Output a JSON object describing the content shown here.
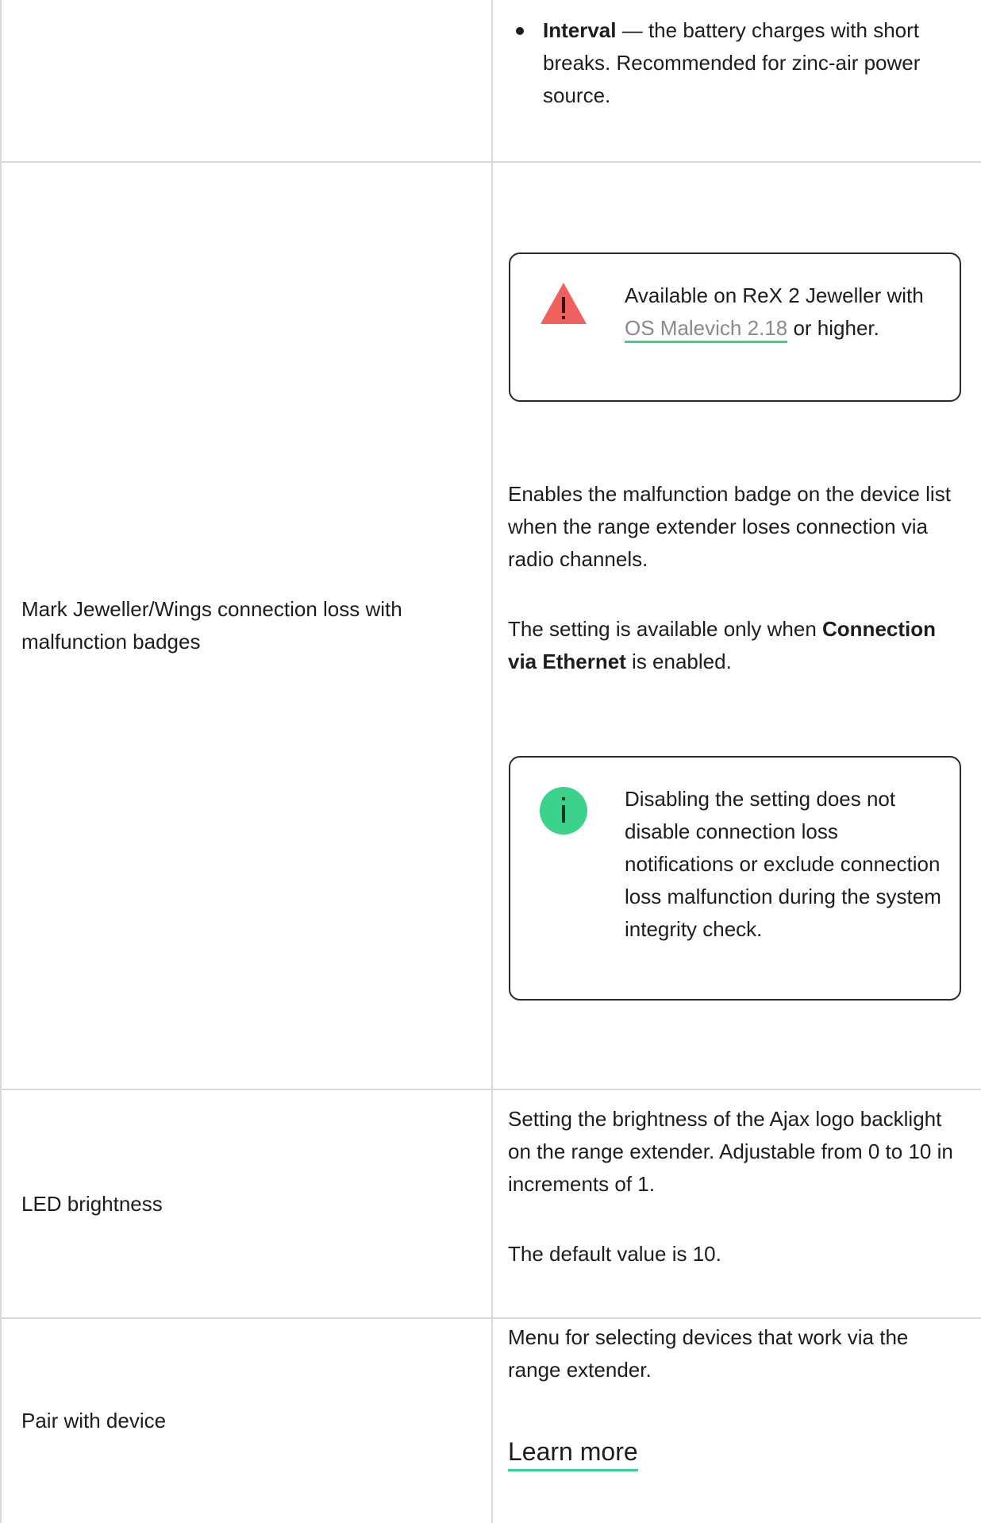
{
  "rows": {
    "battery_mode": {
      "bullet_term": "Interval",
      "bullet_text": " — the battery charges with short breaks. Recommended for zinc-air power source."
    },
    "mark_connection_loss": {
      "label": "Mark Jeweller/Wings connection loss with malfunction badges",
      "warning_callout": {
        "text_before_link": "Available on ReX 2 Jeweller with ",
        "link_text": "OS Malevich 2.18",
        "text_after_link": " or higher."
      },
      "description_1": "Enables the malfunction badge on the device list when the range extender loses connection via radio channels.",
      "description_2_before": "The setting is available only when ",
      "description_2_bold": "Connection via Ethernet",
      "description_2_after": " is enabled.",
      "info_callout": {
        "text": "Disabling the setting does not disable connection loss notifications or exclude connection loss malfunction during the system integrity check."
      }
    },
    "led_brightness": {
      "label": "LED brightness",
      "description_1": "Setting the brightness of the Ajax logo backlight on the range extender. Adjustable from 0 to 10 in increments of 1.",
      "description_2": "The default value is 10."
    },
    "pair_with_device": {
      "label": "Pair with device",
      "description_1": "Menu for selecting devices that work via the range extender.",
      "learn_more": "Learn more"
    }
  },
  "colors": {
    "accent_green": "#3cd28b",
    "warning_red": "#f0605d",
    "info_green": "#3cd28b",
    "border": "#d9d9d9",
    "text": "#1d1d1d",
    "link_gray": "#8a8a8a"
  },
  "icons": {
    "warning": "warning-triangle-icon",
    "info": "info-circle-icon"
  }
}
